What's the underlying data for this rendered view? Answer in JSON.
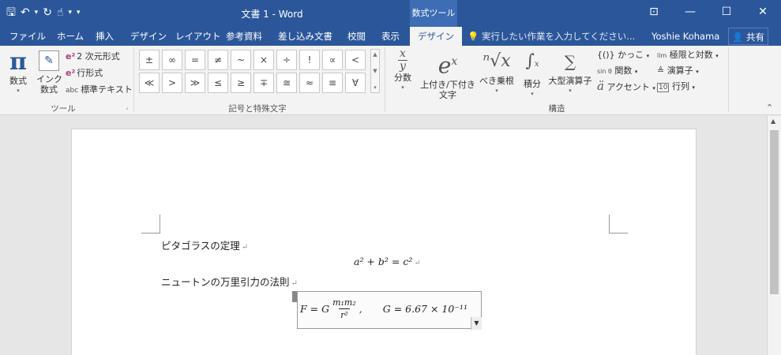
{
  "titlebar": {
    "doc_title": "文書 1 - Word",
    "context_tools": "数式ツール",
    "qat_dropdown": "▾",
    "min": "—",
    "max": "☐",
    "close": "✕",
    "ribbon_opts": "⊡"
  },
  "tabs": {
    "file": "ファイル",
    "home": "ホーム",
    "insert": "挿入",
    "design1": "デザイン",
    "layout": "レイアウト",
    "references": "参考資料",
    "mailings": "差し込み文書",
    "review": "校閲",
    "view": "表示",
    "design_active": "デザイン",
    "tell_me": "実行したい作業を入力してください...",
    "user": "Yoshie Kohama",
    "share": "共有"
  },
  "ribbon": {
    "tools": {
      "equation": "数式",
      "ink": "インク\n数式",
      "professional": "2 次元形式",
      "linear": "行形式",
      "normal_text": "標準テキスト",
      "label": "ツール"
    },
    "symbols": {
      "items": [
        "±",
        "∞",
        "=",
        "≠",
        "~",
        "×",
        "÷",
        "!",
        "∝",
        "<",
        "≪",
        ">",
        "≫",
        "≤",
        "≥",
        "∓",
        "≅",
        "≈",
        "≡",
        "∀"
      ],
      "label": "記号と特殊文字"
    },
    "structures": {
      "fraction": "分数",
      "script": "上付き/下付き\n文字",
      "radical": "べき乗根",
      "integral": "積分",
      "large_operator": "大型演算子",
      "bracket": "{()} かっこ",
      "function": "関数",
      "accent": "アクセント",
      "limit_log": "極限と対数",
      "operator": "演算子",
      "matrix": "行列",
      "label": "構造"
    }
  },
  "document": {
    "line1": "ピタゴラスの定理",
    "eq1": "a² + b² = c²",
    "line2": "ニュートンの万里引力の法則",
    "eq2_left": "F = G",
    "eq2_num": "m₁m₂",
    "eq2_den": "r²",
    "eq2_right": "G = 6.67 × 10⁻¹¹",
    "pilcrow": "↵"
  }
}
